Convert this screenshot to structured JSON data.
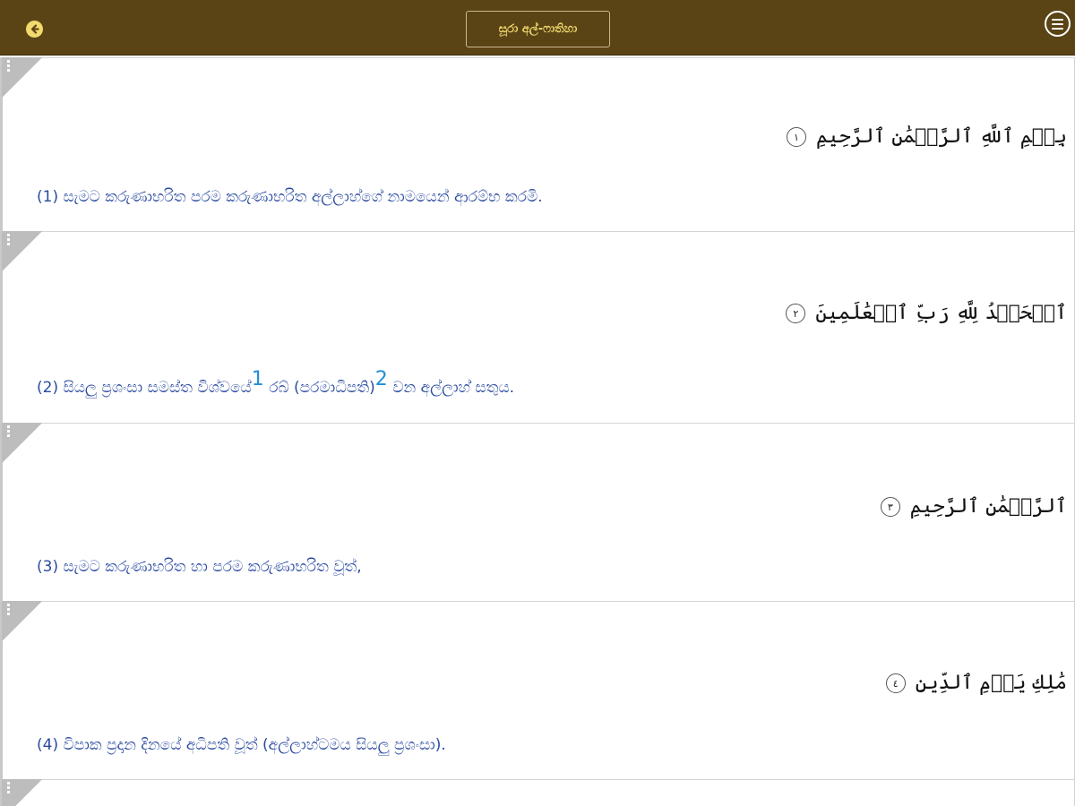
{
  "header": {
    "title": "සූරා අල්-ෆාතිහා",
    "back_icon": "back-arrow-icon",
    "menu_icon": "hamburger-menu-icon",
    "background_color": "#5a4416",
    "accent_color": "#f2da6e"
  },
  "verses": [
    {
      "arabic": "بِسۡمِ ٱللَّهِ ٱلرَّحۡمَٰنِ ٱلرَّحِيمِ",
      "ayah_number": "١",
      "translation": "(1) සැමට කරුණාභරිත පරම කරුණාභරිත අල්ලාහ්ගේ නාමයෙන් ආරම්භ කරමි."
    },
    {
      "arabic": "ٱلۡحَمۡدُ لِلَّهِ رَبِّ ٱلۡعَٰلَمِينَ",
      "ayah_number": "٢",
      "translation_part1": "(2) සියලු ප්‍රශංසා සමස්ත විශ්වයේ",
      "footnote1": "1",
      "translation_part2": " රබ් (පරමාධිපති)",
      "footnote2": "2",
      "translation_part3": " වන අල්ලාහ් සතුය."
    },
    {
      "arabic": "ٱلرَّحۡمَٰنِ ٱلرَّحِيمِ",
      "ayah_number": "٣",
      "translation": "(3) සැමට කරුණාභරිත හා පරම කරුණාභරිත වූත්,"
    },
    {
      "arabic": "مَٰلِكِ يَوۡمِ ٱلدِّينِ",
      "ayah_number": "٤",
      "translation": "(4) විපාක ප්‍රදාන දිනයේ අධිපති වූත් (අල්ලාහ්ටමය සියලු ප්‍රශංසා)."
    }
  ],
  "colors": {
    "translation_text": "#2a4aa0",
    "footnote_link": "#1f8fd6",
    "card_corner": "#bdbdbd"
  }
}
